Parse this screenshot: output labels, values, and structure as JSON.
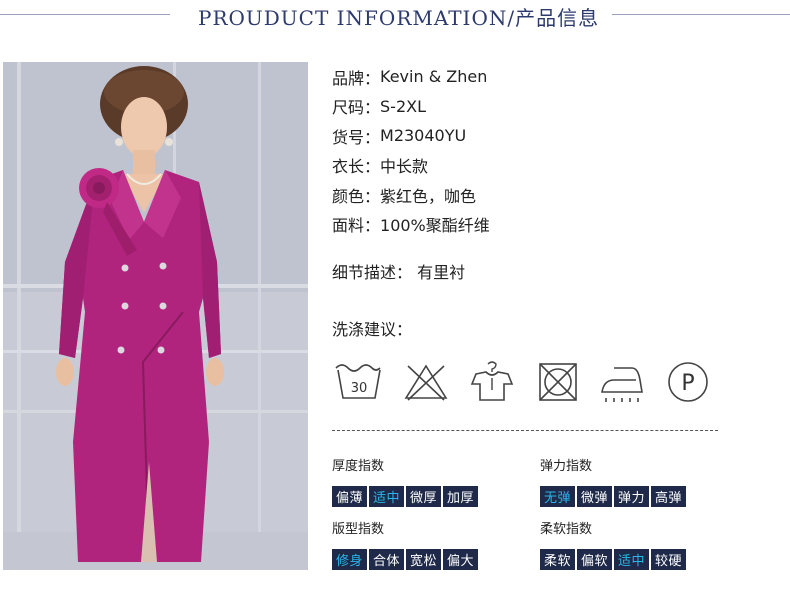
{
  "header": {
    "title": "PROUDUCT INFORMATION/产品信息"
  },
  "info": [
    {
      "key": "品牌：",
      "value": "Kevin & Zhen"
    },
    {
      "key": "尺码：",
      "value": "S-2XL"
    },
    {
      "key": "货号：",
      "value": "M23040YU"
    },
    {
      "key": "衣长：",
      "value": "中长款"
    },
    {
      "key": "颜色：",
      "value": "紫红色，咖色"
    },
    {
      "key": "面料：",
      "value": "100%聚酯纤维"
    }
  ],
  "detail": {
    "key": "细节描述：",
    "value": "有里衬"
  },
  "care": {
    "title": "洗涤建议：",
    "icons": [
      {
        "name": "wash-30-icon",
        "text": "30"
      },
      {
        "name": "do-not-bleach-icon"
      },
      {
        "name": "hang-dry-icon"
      },
      {
        "name": "do-not-tumble-dry-icon"
      },
      {
        "name": "iron-icon"
      },
      {
        "name": "dry-clean-p-icon",
        "text": "P"
      }
    ]
  },
  "indexes": {
    "thickness": {
      "label": "厚度指数",
      "options": [
        "偏薄",
        "适中",
        "微厚",
        "加厚"
      ],
      "active": 1
    },
    "elasticity": {
      "label": "弹力指数",
      "options": [
        "无弹",
        "微弹",
        "弹力",
        "高弹"
      ],
      "active": 0
    },
    "fit": {
      "label": "版型指数",
      "options": [
        "修身",
        "合体",
        "宽松",
        "偏大"
      ],
      "active": 0
    },
    "softness": {
      "label": "柔软指数",
      "options": [
        "柔软",
        "偏软",
        "适中",
        "较硬"
      ],
      "active": 2
    }
  },
  "colors": {
    "accent": "#29b6e8",
    "bar": "#1f2a4a",
    "dress": "#b0247e",
    "title": "#2d3a6e"
  }
}
